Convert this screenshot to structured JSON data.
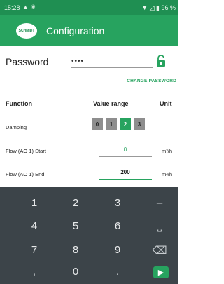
{
  "status_bar": {
    "time": "15:28",
    "icons_left": "▲ ※",
    "icons_right": "▼ ◿ ▮ 96 %"
  },
  "app_bar": {
    "logo_text": "SCHMIDT",
    "title": "Configuration"
  },
  "password": {
    "label": "Password",
    "value": "••••",
    "change_label": "CHANGE PASSWORD"
  },
  "table": {
    "headers": {
      "function": "Function",
      "value_range": "Value range",
      "unit": "Unit"
    },
    "damping": {
      "label": "Damping",
      "options": [
        "0",
        "1",
        "2",
        "3"
      ],
      "selected": "2"
    },
    "flow_start": {
      "label": "Flow (AO 1) Start",
      "value": "0",
      "unit": "m³/h"
    },
    "flow_end": {
      "label": "Flow (AO 1) End",
      "value": "200",
      "unit": "m³/h"
    }
  },
  "keyboard": {
    "keys": [
      "1",
      "2",
      "3",
      "–",
      "4",
      "5",
      "6",
      "⎵",
      "7",
      "8",
      "9",
      "⌫",
      ",",
      "0",
      ".",
      "▶"
    ]
  },
  "colors": {
    "accent": "#27a35f",
    "status_bar": "#1f8f52",
    "keyboard_bg": "#3c4449"
  }
}
